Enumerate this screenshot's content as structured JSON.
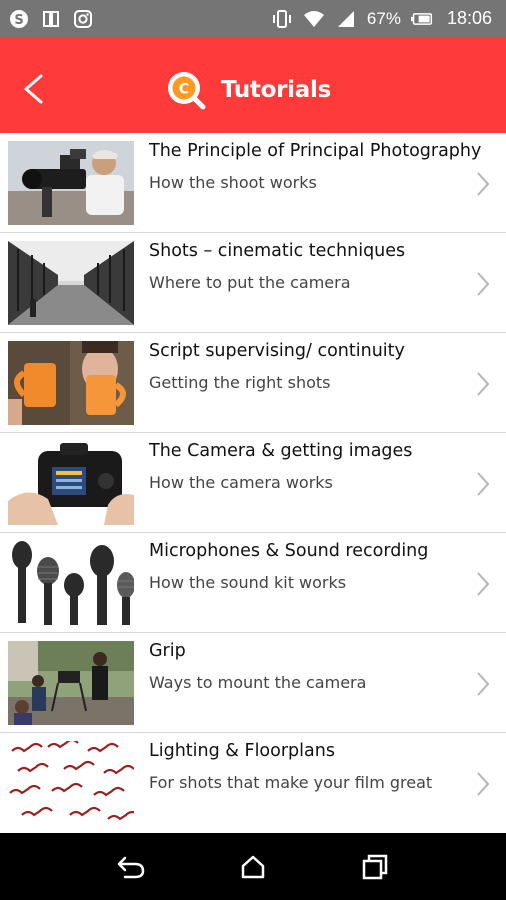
{
  "status_bar": {
    "icons_left": [
      "skype-icon",
      "book-icon",
      "instagram-icon"
    ],
    "icons_right": [
      "vibrate-icon",
      "wifi-icon",
      "signal-icon"
    ],
    "battery": "67%",
    "time": "18:06"
  },
  "header": {
    "title": "Tutorials",
    "back_icon": "back-chevron-icon",
    "logo_letter": "C",
    "color": "#ff3a3a"
  },
  "tutorials": [
    {
      "title": "The Principle of Principal Photography",
      "subtitle": "How the shoot works",
      "thumb": "camera-operator"
    },
    {
      "title": "Shots – cinematic techniques",
      "subtitle": "Where to put the camera",
      "thumb": "tree-lined-road"
    },
    {
      "title": "Script supervising/ continuity",
      "subtitle": "Getting the right shots",
      "thumb": "orange-mugs"
    },
    {
      "title": "The Camera & getting images",
      "subtitle": "How the camera works",
      "thumb": "dslr-camera"
    },
    {
      "title": "Microphones & Sound recording",
      "subtitle": "How the sound kit works",
      "thumb": "microphones"
    },
    {
      "title": "Grip",
      "subtitle": "Ways to mount the camera",
      "thumb": "film-crew"
    },
    {
      "title": "Lighting & Floorplans",
      "subtitle": "For shots that make your film great",
      "thumb": "floorplan-pattern"
    }
  ],
  "nav_bar": {
    "icons": [
      "back-nav-icon",
      "home-nav-icon",
      "recents-nav-icon"
    ]
  }
}
